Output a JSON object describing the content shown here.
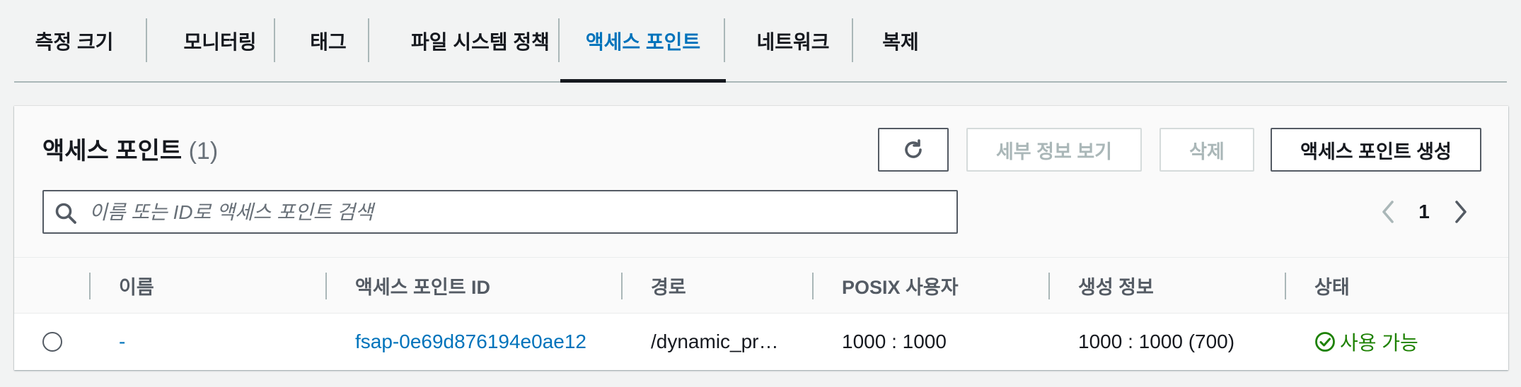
{
  "tabs": [
    {
      "label": "측정 크기"
    },
    {
      "label": "모니터링"
    },
    {
      "label": "태그"
    },
    {
      "label": "파일 시스템 정책"
    },
    {
      "label": "액세스 포인트"
    },
    {
      "label": "네트워크"
    },
    {
      "label": "복제"
    }
  ],
  "active_tab": "액세스 포인트",
  "panel": {
    "title": "액세스 포인트",
    "count": "(1)"
  },
  "toolbar": {
    "refresh_icon": "refresh-icon",
    "details_label": "세부 정보 보기",
    "delete_label": "삭제",
    "create_label": "액세스 포인트 생성"
  },
  "search": {
    "placeholder": "이름 또는 ID로 액세스 포인트 검색",
    "value": ""
  },
  "pagination": {
    "current_page": "1",
    "prev_icon": "chevron-left-icon",
    "next_icon": "chevron-right-icon"
  },
  "table": {
    "columns": [
      "이름",
      "액세스 포인트 ID",
      "경로",
      "POSIX 사용자",
      "생성 정보",
      "상태"
    ],
    "rows": [
      {
        "name": "-",
        "id": "fsap-0e69d876194e0ae12",
        "path": "/dynamic_pr…",
        "posix_user": "1000 : 1000",
        "creation_info": "1000 : 1000 (700)",
        "status": "사용 가능"
      }
    ]
  },
  "colors": {
    "link": "#0073bb",
    "status_ok": "#1d8102",
    "text": "#16191f",
    "muted": "#687078"
  }
}
